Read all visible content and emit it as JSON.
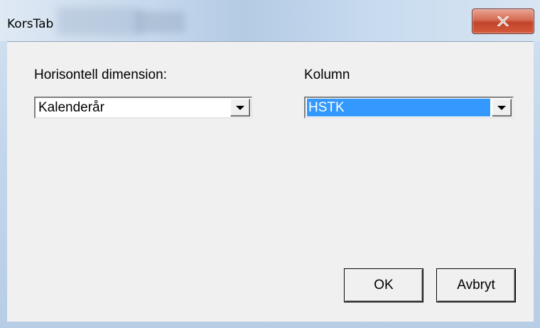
{
  "window": {
    "title": "KorsTab",
    "close_icon": "close-icon"
  },
  "horizontal": {
    "label": "Horisontell dimension:",
    "value": "Kalenderår"
  },
  "column": {
    "label": "Kolumn",
    "value": "HSTK"
  },
  "buttons": {
    "ok": "OK",
    "cancel": "Avbryt"
  },
  "colors": {
    "close_button": "#c1432a",
    "selection": "#3399ff",
    "dialog_background": "#f0f0f0"
  }
}
